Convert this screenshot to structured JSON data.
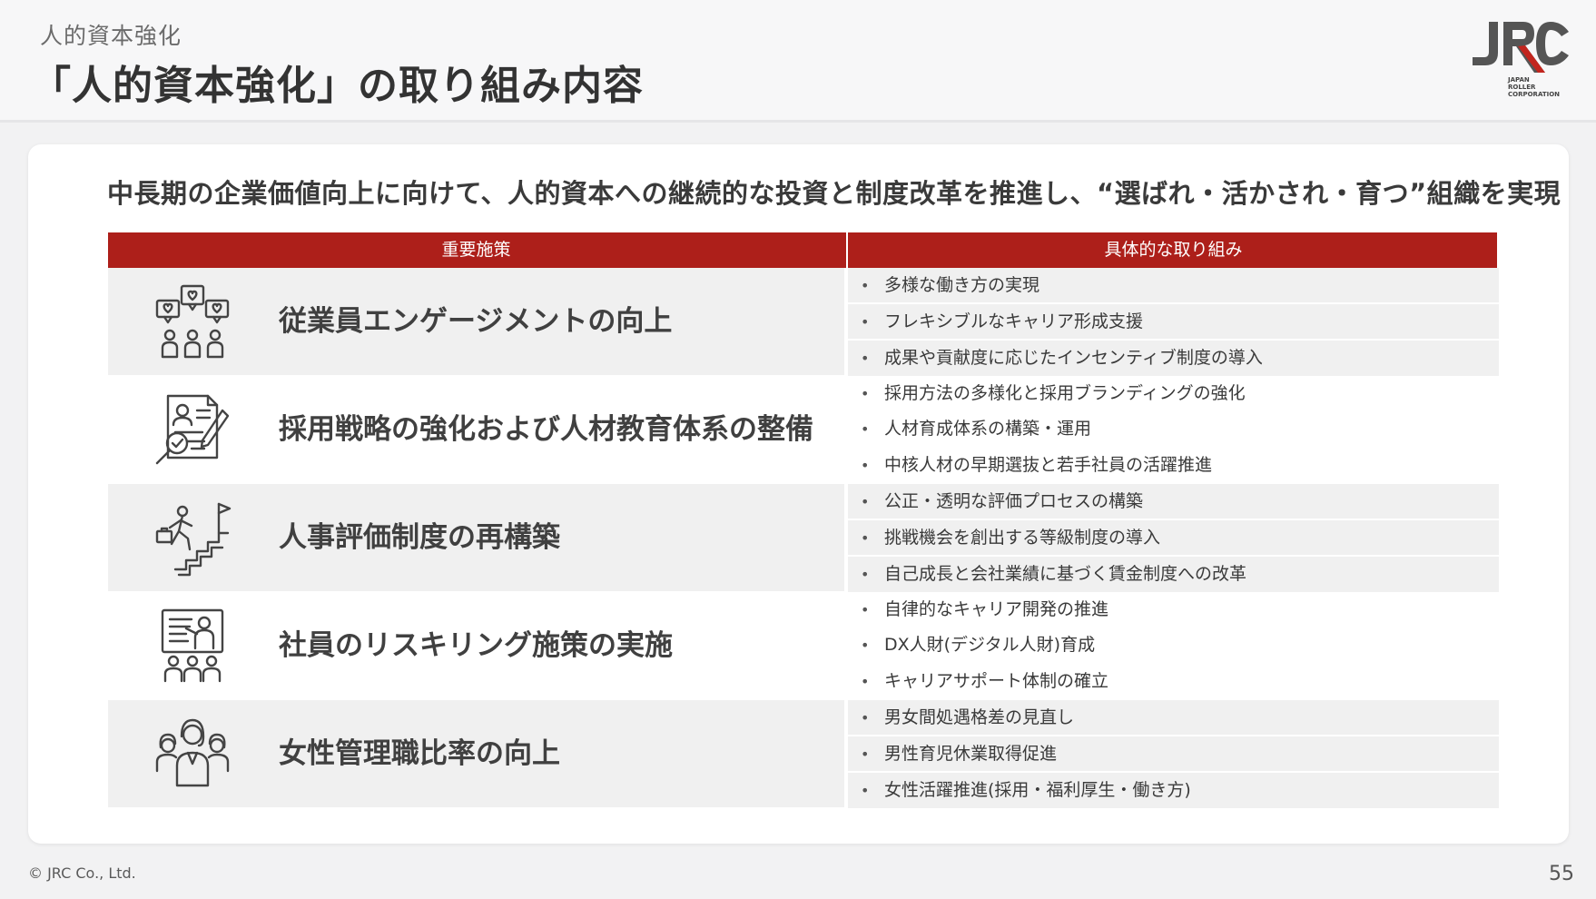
{
  "header": {
    "eyebrow": "人的資本強化",
    "title": "「人的資本強化」の取り組み内容",
    "logo_mark": "JRC",
    "logo_lines": [
      "JAPAN",
      "ROLLER",
      "CORPORATION"
    ]
  },
  "lead": "中長期の企業価値向上に向けて、人的資本への継続的な投資と制度改革を推進し、“選ばれ・活かされ・育つ”組織を実現",
  "table": {
    "headers": [
      "重要施策",
      "具体的な取り組み"
    ],
    "rows": [
      {
        "icon": "engagement-icon",
        "measure": "従業員エンゲージメントの向上",
        "actions": [
          "多様な働き方の実現",
          "フレキシブルなキャリア形成支援",
          "成果や貢献度に応じたインセンティブ制度の導入"
        ]
      },
      {
        "icon": "recruitment-icon",
        "measure": "採用戦略の強化および人材教育体系の整備",
        "actions": [
          "採用方法の多様化と採用ブランディングの強化",
          "人材育成体系の構築・運用",
          "中核人材の早期選抜と若手社員の活躍推進"
        ]
      },
      {
        "icon": "career-stairs-icon",
        "measure": "人事評価制度の再構築",
        "actions": [
          "公正・透明な評価プロセスの構築",
          "挑戦機会を創出する等級制度の導入",
          "自己成長と会社業績に基づく賃金制度への改革"
        ]
      },
      {
        "icon": "training-icon",
        "measure": "社員のリスキリング施策の実施",
        "actions": [
          "自律的なキャリア開発の推進",
          "DX人財(デジタル人財)育成",
          "キャリアサポート体制の確立"
        ]
      },
      {
        "icon": "women-managers-icon",
        "measure": "女性管理職比率の向上",
        "actions": [
          "男女間処遇格差の見直し",
          "男性育児休業取得促進",
          "女性活躍推進(採用・福利厚生・働き方)"
        ]
      }
    ]
  },
  "footer": {
    "copyright": "© JRC Co., Ltd.",
    "page": "55"
  },
  "colors": {
    "accent": "#ad1f1a",
    "row_shade": "#f0f0f0"
  }
}
